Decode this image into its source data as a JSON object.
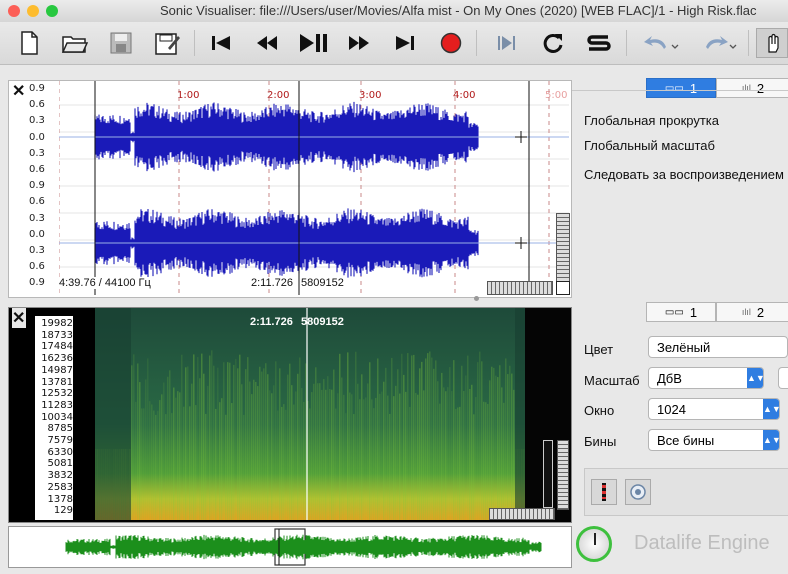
{
  "window": {
    "title": "Sonic Visualiser: file:///Users/user/Movies/Alfa mist - On My Ones (2020) [WEB FLAC]/1 - High Risk.flac"
  },
  "waveform": {
    "scale_labels": [
      "0.9",
      "0.6",
      "0.3",
      "0.0",
      "0.3",
      "0.6",
      "0.9",
      "0.6",
      "0.3",
      "0.0",
      "0.3",
      "0.6",
      "0.9"
    ],
    "time_labels": [
      "1:00",
      "2:00",
      "3:00",
      "4:00",
      "5:00"
    ],
    "duration_info": "4:39.76 / 44100 Гц",
    "cursor_time": "2:11.726",
    "cursor_frame": "5809152"
  },
  "spectrogram": {
    "freq_labels": [
      "19982",
      "18733",
      "17484",
      "16236",
      "14987",
      "13781",
      "12532",
      "11283",
      "10034",
      "8785",
      "7579",
      "6330",
      "5081",
      "3832",
      "2583",
      "1378",
      "129"
    ],
    "cursor_time": "2:11.726",
    "cursor_frame": "5809152"
  },
  "props_top": {
    "tabs": [
      "1",
      "2"
    ],
    "rows": [
      "Глобальная прокрутка",
      "Глобальный масштаб",
      "Следовать за воспроизведением"
    ]
  },
  "props_bottom": {
    "tabs": [
      "1",
      "2"
    ],
    "color_label": "Цвет",
    "color_value": "Зелёный",
    "scale_label": "Масштаб",
    "scale_value": "ДбВ",
    "window_label": "Окно",
    "window_value": "1024",
    "bins_label": "Бины",
    "bins_value": "Все бины"
  },
  "watermark": "Datalife Engine",
  "colors": {
    "wave": "#1a1ab8",
    "accent": "#2f7de1",
    "overview_wave": "#1c8f1c",
    "time_label": "#b01818"
  }
}
